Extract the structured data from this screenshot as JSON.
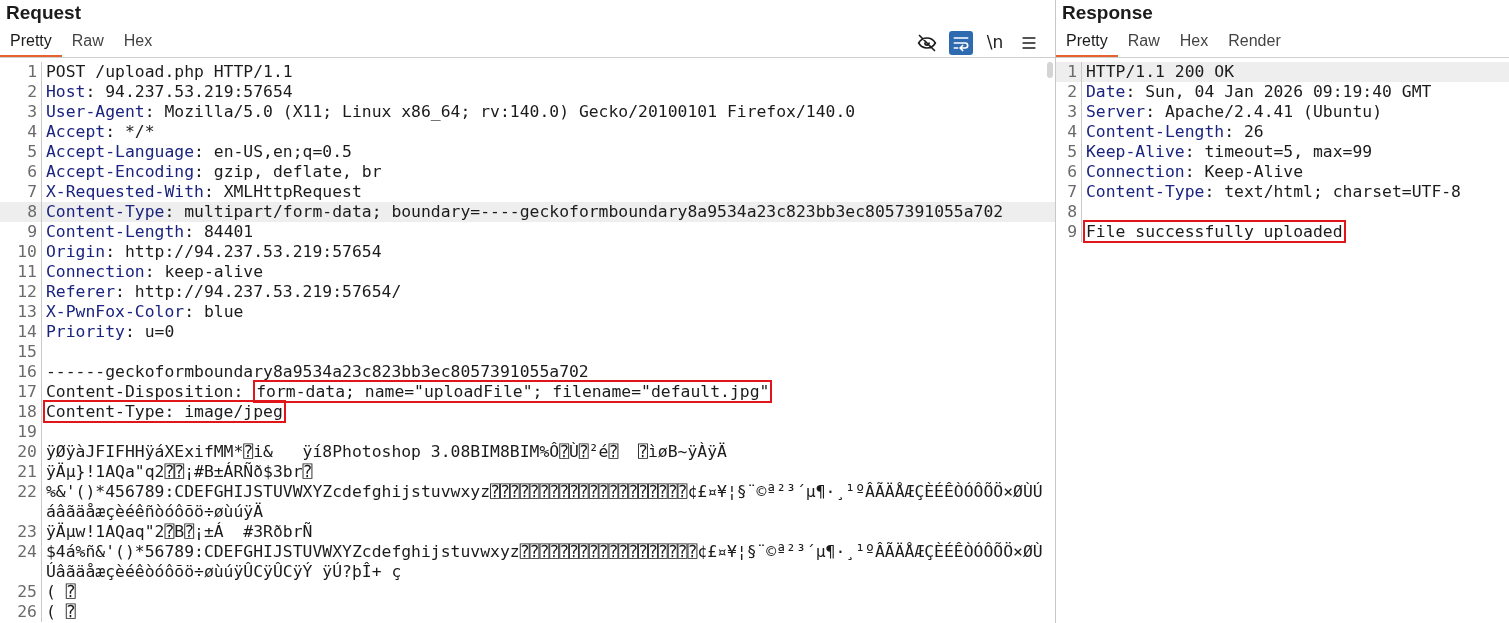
{
  "request": {
    "title": "Request",
    "tabs": [
      {
        "label": "Pretty",
        "selected": true
      },
      {
        "label": "Raw",
        "selected": false
      },
      {
        "label": "Hex",
        "selected": false
      }
    ],
    "toolbar": [
      {
        "kind": "hide",
        "on": false
      },
      {
        "kind": "wrap",
        "on": true
      },
      {
        "kind": "newline",
        "label": "\\n",
        "on": false
      },
      {
        "kind": "menu",
        "on": false
      }
    ],
    "lines": [
      {
        "n": "1",
        "highlighted": false,
        "boxed": false,
        "segments": [
          {
            "text": "POST /upload.php HTTP/1.1",
            "kind": "text",
            "boxed": false
          }
        ]
      },
      {
        "n": "2",
        "highlighted": false,
        "boxed": false,
        "segments": [
          {
            "text": "Host",
            "kind": "name",
            "boxed": false
          },
          {
            "text": ": 94.237.53.219:57654",
            "kind": "text",
            "boxed": false
          }
        ]
      },
      {
        "n": "3",
        "highlighted": false,
        "boxed": false,
        "segments": [
          {
            "text": "User-Agent",
            "kind": "name",
            "boxed": false
          },
          {
            "text": ": Mozilla/5.0 (X11; Linux x86_64; rv:140.0) Gecko/20100101 Firefox/140.0",
            "kind": "text",
            "boxed": false
          }
        ]
      },
      {
        "n": "4",
        "highlighted": false,
        "boxed": false,
        "segments": [
          {
            "text": "Accept",
            "kind": "name",
            "boxed": false
          },
          {
            "text": ": */*",
            "kind": "text",
            "boxed": false
          }
        ]
      },
      {
        "n": "5",
        "highlighted": false,
        "boxed": false,
        "segments": [
          {
            "text": "Accept-Language",
            "kind": "name",
            "boxed": false
          },
          {
            "text": ": en-US,en;q=0.5",
            "kind": "text",
            "boxed": false
          }
        ]
      },
      {
        "n": "6",
        "highlighted": false,
        "boxed": false,
        "segments": [
          {
            "text": "Accept-Encoding",
            "kind": "name",
            "boxed": false
          },
          {
            "text": ": gzip, deflate, br",
            "kind": "text",
            "boxed": false
          }
        ]
      },
      {
        "n": "7",
        "highlighted": false,
        "boxed": false,
        "segments": [
          {
            "text": "X-Requested-With",
            "kind": "name",
            "boxed": false
          },
          {
            "text": ": XMLHttpRequest",
            "kind": "text",
            "boxed": false
          }
        ]
      },
      {
        "n": "8",
        "highlighted": true,
        "boxed": false,
        "segments": [
          {
            "text": "Content-Type",
            "kind": "name",
            "boxed": false
          },
          {
            "text": ": multipart/form-data; boundary=----geckoformboundary8a9534a23c823bb3ec8057391055a702",
            "kind": "text",
            "boxed": false
          }
        ]
      },
      {
        "n": "9",
        "highlighted": false,
        "boxed": false,
        "segments": [
          {
            "text": "Content-Length",
            "kind": "name",
            "boxed": false
          },
          {
            "text": ": 84401",
            "kind": "text",
            "boxed": false
          }
        ]
      },
      {
        "n": "10",
        "highlighted": false,
        "boxed": false,
        "segments": [
          {
            "text": "Origin",
            "kind": "name",
            "boxed": false
          },
          {
            "text": ": http://94.237.53.219:57654",
            "kind": "text",
            "boxed": false
          }
        ]
      },
      {
        "n": "11",
        "highlighted": false,
        "boxed": false,
        "segments": [
          {
            "text": "Connection",
            "kind": "name",
            "boxed": false
          },
          {
            "text": ": keep-alive",
            "kind": "text",
            "boxed": false
          }
        ]
      },
      {
        "n": "12",
        "highlighted": false,
        "boxed": false,
        "segments": [
          {
            "text": "Referer",
            "kind": "name",
            "boxed": false
          },
          {
            "text": ": http://94.237.53.219:57654/",
            "kind": "text",
            "boxed": false
          }
        ]
      },
      {
        "n": "13",
        "highlighted": false,
        "boxed": false,
        "segments": [
          {
            "text": "X-PwnFox-Color",
            "kind": "name",
            "boxed": false
          },
          {
            "text": ": blue",
            "kind": "text",
            "boxed": false
          }
        ]
      },
      {
        "n": "14",
        "highlighted": false,
        "boxed": false,
        "segments": [
          {
            "text": "Priority",
            "kind": "name",
            "boxed": false
          },
          {
            "text": ": u=0",
            "kind": "text",
            "boxed": false
          }
        ]
      },
      {
        "n": "15",
        "highlighted": false,
        "boxed": false
      },
      {
        "n": "16",
        "highlighted": false,
        "boxed": false,
        "segments": [
          {
            "text": "------geckoformboundary8a9534a23c823bb3ec8057391055a702",
            "kind": "text",
            "boxed": false
          }
        ]
      },
      {
        "n": "17",
        "highlighted": false,
        "boxed": false,
        "segments": [
          {
            "text": "Content-Disposition: ",
            "kind": "text",
            "boxed": false
          },
          {
            "text": "form-data; name=\"uploadFile\"; filename=\"default.jpg\"",
            "kind": "text",
            "boxed": true
          }
        ]
      },
      {
        "n": "18",
        "highlighted": false,
        "boxed": true,
        "segments": [
          {
            "text": "Content-Type: image/jpeg",
            "kind": "text",
            "boxed": false
          }
        ]
      },
      {
        "n": "19",
        "highlighted": false,
        "boxed": false
      },
      {
        "n": "20",
        "highlighted": false,
        "boxed": false,
        "segments": [
          {
            "text": "ÿØÿàJFIFHHÿáXExifMM*⍰i&   ÿí8Photoshop 3.08BIM8BIM%Ô⍰Ù⍰²é⍰  ⍰ìøB~ÿÀÿÄ",
            "kind": "text",
            "boxed": false
          }
        ]
      },
      {
        "n": "21",
        "highlighted": false,
        "boxed": false,
        "segments": [
          {
            "text": "ÿÄµ}!1AQa\"q2⍰⍰¡#B±ÁRÑð$3br⍰",
            "kind": "text",
            "boxed": false
          }
        ]
      },
      {
        "n": "22",
        "highlighted": false,
        "boxed": false,
        "segments": [
          {
            "text": "%&'()*456789:CDEFGHIJSTUVWXYZcdefghijstuvwxyz⍰⍰⍰⍰⍰⍰⍰⍰⍰⍰⍰⍰⍰⍰⍰⍰⍰⍰⍰⍰¢£¤¥¦§¨©ª²³´µ¶·¸¹ºÂÃÄÅÆÇÈÉÊÒÓÔÕÖ×ØÙÚáâãäåæçèéêñòóôõö÷øùúÿÄ",
            "kind": "text",
            "boxed": false
          }
        ]
      },
      {
        "n": "23",
        "highlighted": false,
        "boxed": false,
        "segments": [
          {
            "text": "ÿÄµw!1AQaq\"2⍰B⍰¡±Á  #3RðbrÑ",
            "kind": "text",
            "boxed": false
          }
        ]
      },
      {
        "n": "24",
        "highlighted": false,
        "boxed": false,
        "segments": [
          {
            "text": "$4á%ñ&'()*56789:CDEFGHIJSTUVWXYZcdefghijstuvwxyz⍰⍰⍰⍰⍰⍰⍰⍰⍰⍰⍰⍰⍰⍰⍰⍰⍰⍰¢£¤¥¦§¨©ª²³´µ¶·¸¹ºÂÃÄÅÆÇÈÉÊÒÓÔÕÖ×ØÙÚâãäåæçèéêòóôõö÷øùúÿÛCÿÛCÿÝ ÿÚ?þÎ+ ç",
            "kind": "text",
            "boxed": false
          }
        ]
      },
      {
        "n": "25",
        "highlighted": false,
        "boxed": false,
        "segments": [
          {
            "text": "( ⍰",
            "kind": "text",
            "boxed": false
          }
        ]
      },
      {
        "n": "26",
        "highlighted": false,
        "boxed": false,
        "segments": [
          {
            "text": "( ⍰",
            "kind": "text",
            "boxed": false
          }
        ]
      }
    ]
  },
  "response": {
    "title": "Response",
    "tabs": [
      {
        "label": "Pretty",
        "selected": true
      },
      {
        "label": "Raw",
        "selected": false
      },
      {
        "label": "Hex",
        "selected": false
      },
      {
        "label": "Render",
        "selected": false
      }
    ],
    "lines": [
      {
        "n": "1",
        "highlighted": true,
        "boxed": false,
        "segments": [
          {
            "text": "HTTP/1.1 200 OK",
            "kind": "text",
            "boxed": false
          }
        ]
      },
      {
        "n": "2",
        "highlighted": false,
        "boxed": false,
        "segments": [
          {
            "text": "Date",
            "kind": "name",
            "boxed": false
          },
          {
            "text": ": Sun, 04 Jan 2026 09:19:40 GMT",
            "kind": "text",
            "boxed": false
          }
        ]
      },
      {
        "n": "3",
        "highlighted": false,
        "boxed": false,
        "segments": [
          {
            "text": "Server",
            "kind": "name",
            "boxed": false
          },
          {
            "text": ": Apache/2.4.41 (Ubuntu)",
            "kind": "text",
            "boxed": false
          }
        ]
      },
      {
        "n": "4",
        "highlighted": false,
        "boxed": false,
        "segments": [
          {
            "text": "Content-Length",
            "kind": "name",
            "boxed": false
          },
          {
            "text": ": 26",
            "kind": "text",
            "boxed": false
          }
        ]
      },
      {
        "n": "5",
        "highlighted": false,
        "boxed": false,
        "segments": [
          {
            "text": "Keep-Alive",
            "kind": "name",
            "boxed": false
          },
          {
            "text": ": timeout=5, max=99",
            "kind": "text",
            "boxed": false
          }
        ]
      },
      {
        "n": "6",
        "highlighted": false,
        "boxed": false,
        "segments": [
          {
            "text": "Connection",
            "kind": "name",
            "boxed": false
          },
          {
            "text": ": Keep-Alive",
            "kind": "text",
            "boxed": false
          }
        ]
      },
      {
        "n": "7",
        "highlighted": false,
        "boxed": false,
        "segments": [
          {
            "text": "Content-Type",
            "kind": "name",
            "boxed": false
          },
          {
            "text": ": text/html; charset=UTF-8",
            "kind": "text",
            "boxed": false
          }
        ]
      },
      {
        "n": "8",
        "highlighted": false,
        "boxed": false
      },
      {
        "n": "9",
        "highlighted": false,
        "boxed": true,
        "segments": [
          {
            "text": "File successfully uploaded",
            "kind": "text",
            "boxed": false
          }
        ]
      }
    ]
  }
}
